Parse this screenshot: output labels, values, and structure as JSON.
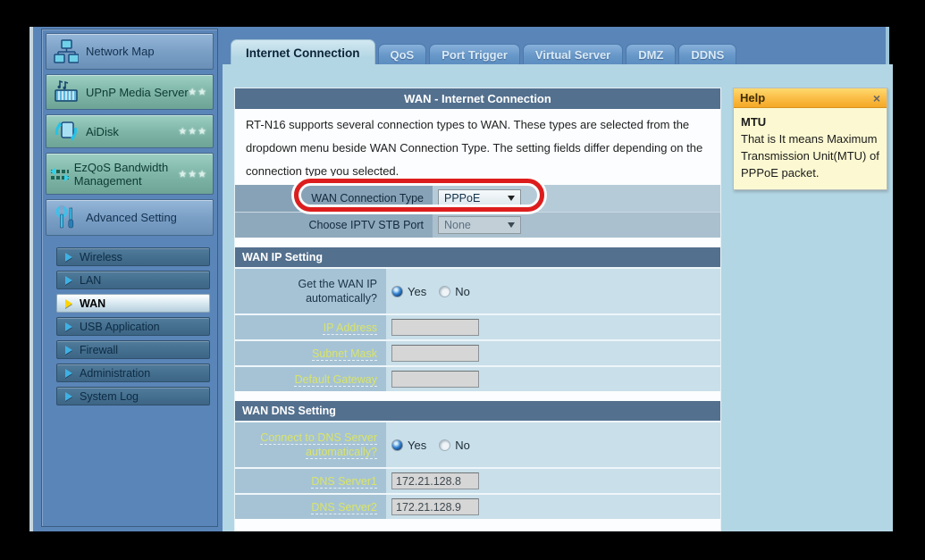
{
  "tabs": [
    {
      "label": "Internet Connection",
      "active": true
    },
    {
      "label": "QoS",
      "active": false
    },
    {
      "label": "Port Trigger",
      "active": false
    },
    {
      "label": "Virtual Server",
      "active": false
    },
    {
      "label": "DMZ",
      "active": false
    },
    {
      "label": "DDNS",
      "active": false
    }
  ],
  "sidebar": {
    "items": [
      {
        "label": "Network Map",
        "stars": ""
      },
      {
        "label": "UPnP Media Server",
        "stars": "★★"
      },
      {
        "label": "AiDisk",
        "stars": "★★★"
      },
      {
        "label": "EzQoS Bandwidth Management",
        "stars": "★★★"
      },
      {
        "label": "Advanced Setting",
        "stars": ""
      }
    ],
    "sub_items": [
      {
        "label": "Wireless"
      },
      {
        "label": "LAN"
      },
      {
        "label": "WAN"
      },
      {
        "label": "USB Application"
      },
      {
        "label": "Firewall"
      },
      {
        "label": "Administration"
      },
      {
        "label": "System Log"
      }
    ],
    "active_sub_item": "WAN"
  },
  "main": {
    "title": "WAN - Internet Connection",
    "intro": "RT-N16 supports several connection types to WAN. These types are selected from the dropdown menu beside WAN Connection Type. The setting fields differ depending on the connection type you selected.",
    "conn": {
      "row1_label": "WAN Connection Type",
      "row1_value": "PPPoE",
      "row2_label": "Choose IPTV STB Port",
      "row2_value": "None"
    },
    "wan_ip": {
      "title": "WAN IP Setting",
      "auto_label": "Get the WAN IP automatically?",
      "yes": "Yes",
      "no": "No",
      "selected": "Yes",
      "rows": [
        {
          "label": "IP Address",
          "value": ""
        },
        {
          "label": "Subnet Mask",
          "value": ""
        },
        {
          "label": "Default Gateway",
          "value": ""
        }
      ]
    },
    "dns": {
      "title": "WAN DNS Setting",
      "auto_label": "Connect to DNS Server automatically?",
      "yes": "Yes",
      "no": "No",
      "selected": "Yes",
      "rows": [
        {
          "label": "DNS Server1",
          "value": "172.21.128.8"
        },
        {
          "label": "DNS Server2",
          "value": "172.21.128.9"
        }
      ]
    }
  },
  "help": {
    "title": "Help",
    "close": "×",
    "term": "MTU",
    "description": "That is It means Maximum Transmission Unit(MTU) of PPPoE packet."
  },
  "colors": {
    "highlight_red": "#dd1d1d",
    "link_green": "#d9e468",
    "header_bar": "#53708e",
    "panel_blue": "#b3d6e4",
    "page_blue": "#5a85b8",
    "help_yellow": "#fcf9d2",
    "help_orange": "#fbc04a"
  }
}
